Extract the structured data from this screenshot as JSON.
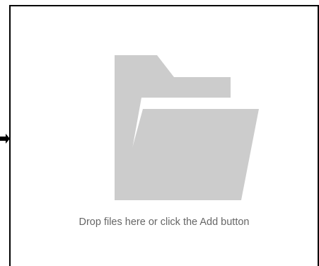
{
  "dropzone": {
    "hint_text": "Drop files here or click the Add button",
    "icon": "folder-open-icon",
    "border_color": "#000000",
    "icon_color": "#cccccc",
    "text_color": "#666666"
  },
  "pointer": {
    "icon": "arrow-pointer-icon"
  }
}
